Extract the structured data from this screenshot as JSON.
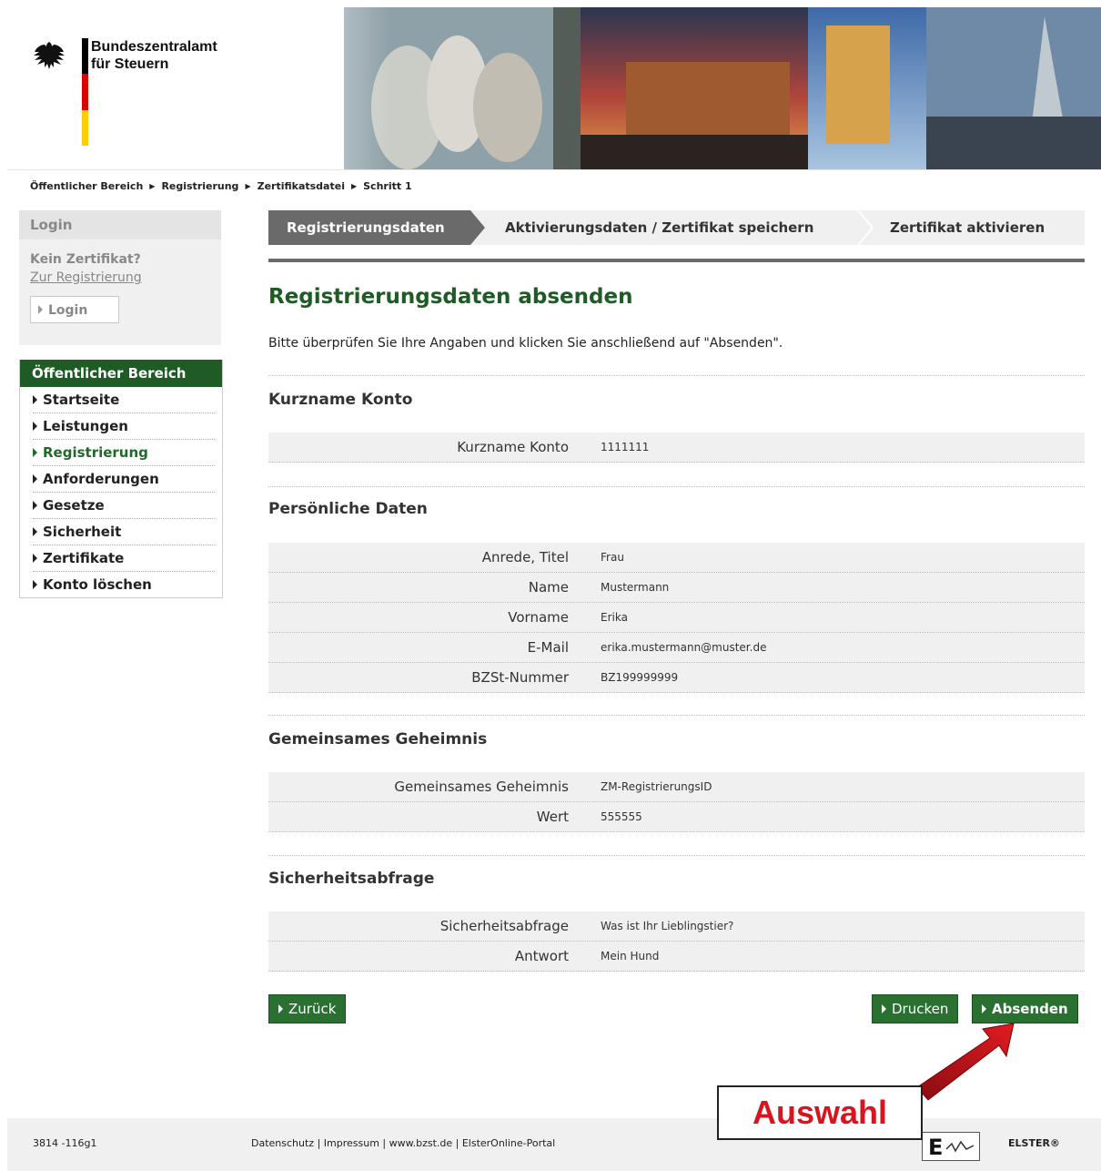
{
  "header": {
    "org_line1": "Bundeszentralamt",
    "org_line2": "für Steuern"
  },
  "breadcrumb": [
    "Öffentlicher Bereich",
    "Registrierung",
    "Zertifikatsdatei",
    "Schritt 1"
  ],
  "sidebar": {
    "login_title": "Login",
    "no_cert": "Kein Zertifikat?",
    "register_link": "Zur Registrierung",
    "login_button": "Login",
    "nav_title": "Öffentlicher Bereich",
    "nav_items": [
      {
        "label": "Startseite"
      },
      {
        "label": "Leistungen"
      },
      {
        "label": "Registrierung"
      },
      {
        "label": "Anforderungen"
      },
      {
        "label": "Gesetze"
      },
      {
        "label": "Sicherheit"
      },
      {
        "label": "Zertifikate"
      },
      {
        "label": "Konto löschen"
      }
    ]
  },
  "steps": [
    "Registrierungsdaten",
    "Aktivierungsdaten / Zertifikat speichern",
    "Zertifikat aktivieren"
  ],
  "main": {
    "title": "Registrierungsdaten absenden",
    "intro": "Bitte überprüfen Sie Ihre Angaben und klicken Sie anschließend auf \"Absenden\".",
    "sections": [
      {
        "title": "Kurzname Konto",
        "rows": [
          {
            "label": "Kurzname Konto",
            "value": "1111111"
          }
        ]
      },
      {
        "title": "Persönliche Daten",
        "rows": [
          {
            "label": "Anrede, Titel",
            "value": "Frau"
          },
          {
            "label": "Name",
            "value": "Mustermann"
          },
          {
            "label": "Vorname",
            "value": "Erika"
          },
          {
            "label": "E-Mail",
            "value": "erika.mustermann@muster.de"
          },
          {
            "label": "BZSt-Nummer",
            "value": "BZ199999999"
          }
        ]
      },
      {
        "title": "Gemeinsames Geheimnis",
        "rows": [
          {
            "label": "Gemeinsames Geheimnis",
            "value": "ZM-RegistrierungsID"
          },
          {
            "label": "Wert",
            "value": "555555"
          }
        ]
      },
      {
        "title": "Sicherheitsabfrage",
        "rows": [
          {
            "label": "Sicherheitsabfrage",
            "value": "Was ist Ihr Lieblingstier?"
          },
          {
            "label": "Antwort",
            "value": "Mein Hund"
          }
        ]
      }
    ],
    "back_button": "Zurück",
    "print_button": "Drucken",
    "submit_button": "Absenden"
  },
  "footer": {
    "version": "3814 -116g1",
    "links": "Datenschutz | Impressum | www.bzst.de | ElsterOnline-Portal",
    "brand": "ELSTER®"
  },
  "annotation": {
    "label": "Auswahl",
    "color": "#d8141e"
  },
  "colors": {
    "primary_green": "#1f5b25",
    "button_green": "#2a7031",
    "step_active": "#6a6a6a"
  }
}
